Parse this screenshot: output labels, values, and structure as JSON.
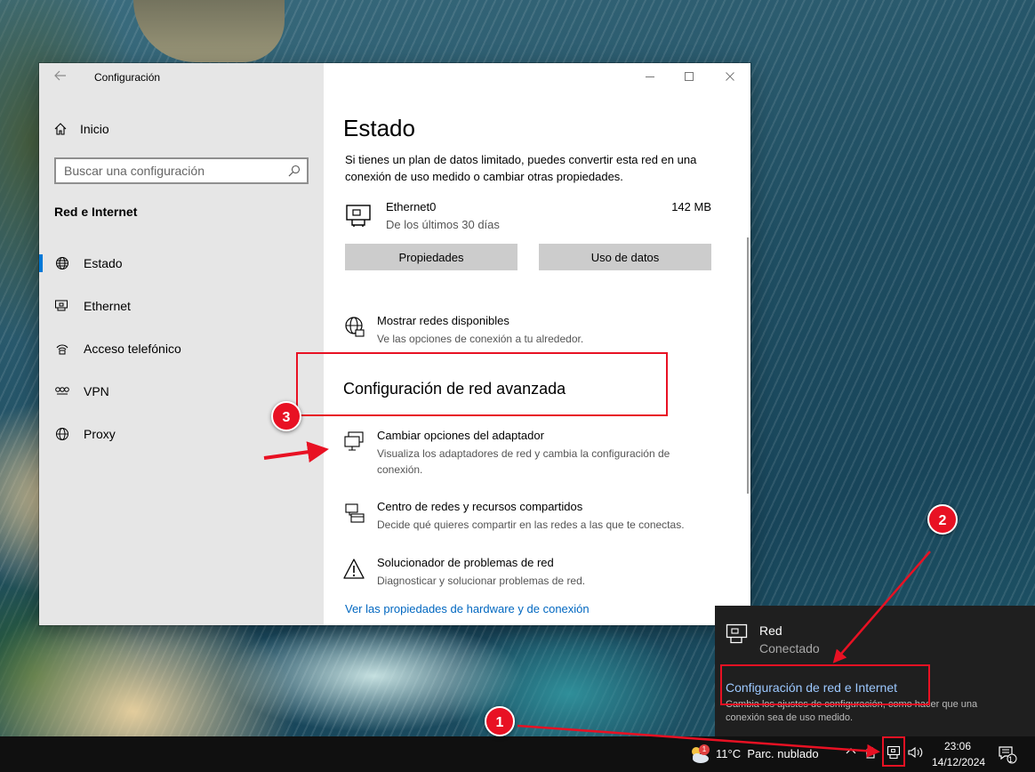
{
  "window": {
    "title": "Configuración",
    "nav": {
      "home": "Inicio",
      "search_placeholder": "Buscar una configuración",
      "section": "Red e Internet",
      "items": [
        {
          "label": "Estado",
          "icon": "globe-icon",
          "selected": true
        },
        {
          "label": "Ethernet",
          "icon": "ethernet-icon",
          "selected": false
        },
        {
          "label": "Acceso telefónico",
          "icon": "dialup-icon",
          "selected": false
        },
        {
          "label": "VPN",
          "icon": "vpn-icon",
          "selected": false
        },
        {
          "label": "Proxy",
          "icon": "globe-icon",
          "selected": false
        }
      ]
    },
    "content": {
      "title": "Estado",
      "intro": "Si tienes un plan de datos limitado, puedes convertir esta red en una conexión de uso medido o cambiar otras propiedades.",
      "connection": {
        "name": "Ethernet0",
        "subtitle": "De los últimos 30 días",
        "usage": "142 MB"
      },
      "buttons": {
        "properties": "Propiedades",
        "data_usage": "Uso de datos"
      },
      "show_networks": {
        "title": "Mostrar redes disponibles",
        "desc": "Ve las opciones de conexión a tu alrededor."
      },
      "advanced_title": "Configuración de red avanzada",
      "adapter": {
        "title": "Cambiar opciones del adaptador",
        "desc": "Visualiza los adaptadores de red y cambia la configuración de conexión."
      },
      "sharing": {
        "title": "Centro de redes y recursos compartidos",
        "desc": "Decide qué quieres compartir en las redes a las que te conectas."
      },
      "troubleshoot": {
        "title": "Solucionador de problemas de red",
        "desc": "Diagnosticar y solucionar problemas de red."
      },
      "hardware_link": "Ver las propiedades de hardware y de conexión"
    }
  },
  "flyout": {
    "network_name": "Red",
    "status": "Conectado",
    "settings_link": "Configuración de red e Internet",
    "settings_desc": "Cambia los ajustes de configuración, como hacer que una conexión sea de uso medido."
  },
  "taskbar": {
    "weather_badge": "1",
    "weather_temp": "11°C",
    "weather_text": "Parc. nublado",
    "time": "23:06",
    "date": "14/12/2024",
    "notification_count": "1"
  },
  "annotations": {
    "step1": "1",
    "step2": "2",
    "step3": "3",
    "color": "#e81123"
  },
  "colors": {
    "accent": "#0078d7",
    "link": "#0067c0",
    "flyout_link": "#9cc8ff"
  }
}
